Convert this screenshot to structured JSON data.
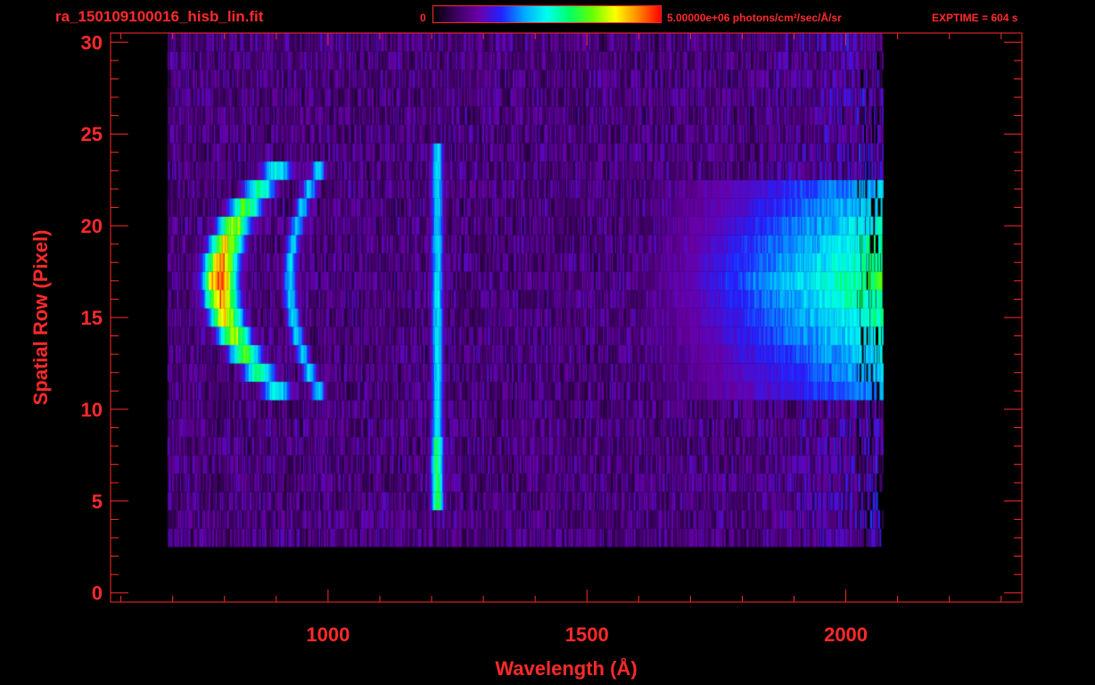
{
  "header": {
    "file_name": "ra_150109100016_hisb_lin.fit",
    "exptime": "EXPTIME = 604 s"
  },
  "colorbar": {
    "min_label": "0",
    "max_label": "5.00000e+06 photons/cm²/sec/Å/sr",
    "stops": [
      "#000000",
      "#3b0060",
      "#6a00a8",
      "#2222ff",
      "#00aaff",
      "#00ffee",
      "#00ff66",
      "#66ff00",
      "#ffff00",
      "#ff8800",
      "#ff0000"
    ]
  },
  "colors": {
    "axis": "#ff2a2a",
    "background": "#000000"
  },
  "chart_data": {
    "type": "heatmap",
    "xlabel": "Wavelength (Å)",
    "ylabel": "Spatial Row (Pixel)",
    "xlim": [
      580,
      2340
    ],
    "ylim": [
      -0.5,
      30.5
    ],
    "x_ticks": [
      1000,
      1500,
      2000
    ],
    "y_ticks": [
      0,
      5,
      10,
      15,
      20,
      25,
      30
    ],
    "grid": false,
    "features": [
      {
        "label": "",
        "x_range": [
          780,
          980
        ],
        "y_range": [
          11,
          23
        ],
        "peak": 1.0
      },
      {
        "label": "",
        "x_range": [
          1195,
          1225
        ],
        "y_range": [
          5,
          24
        ],
        "peak": 0.5
      },
      {
        "label": "",
        "x_range": [
          1650,
          2065
        ],
        "y_range": [
          11,
          23
        ],
        "peak": 0.65
      }
    ]
  }
}
